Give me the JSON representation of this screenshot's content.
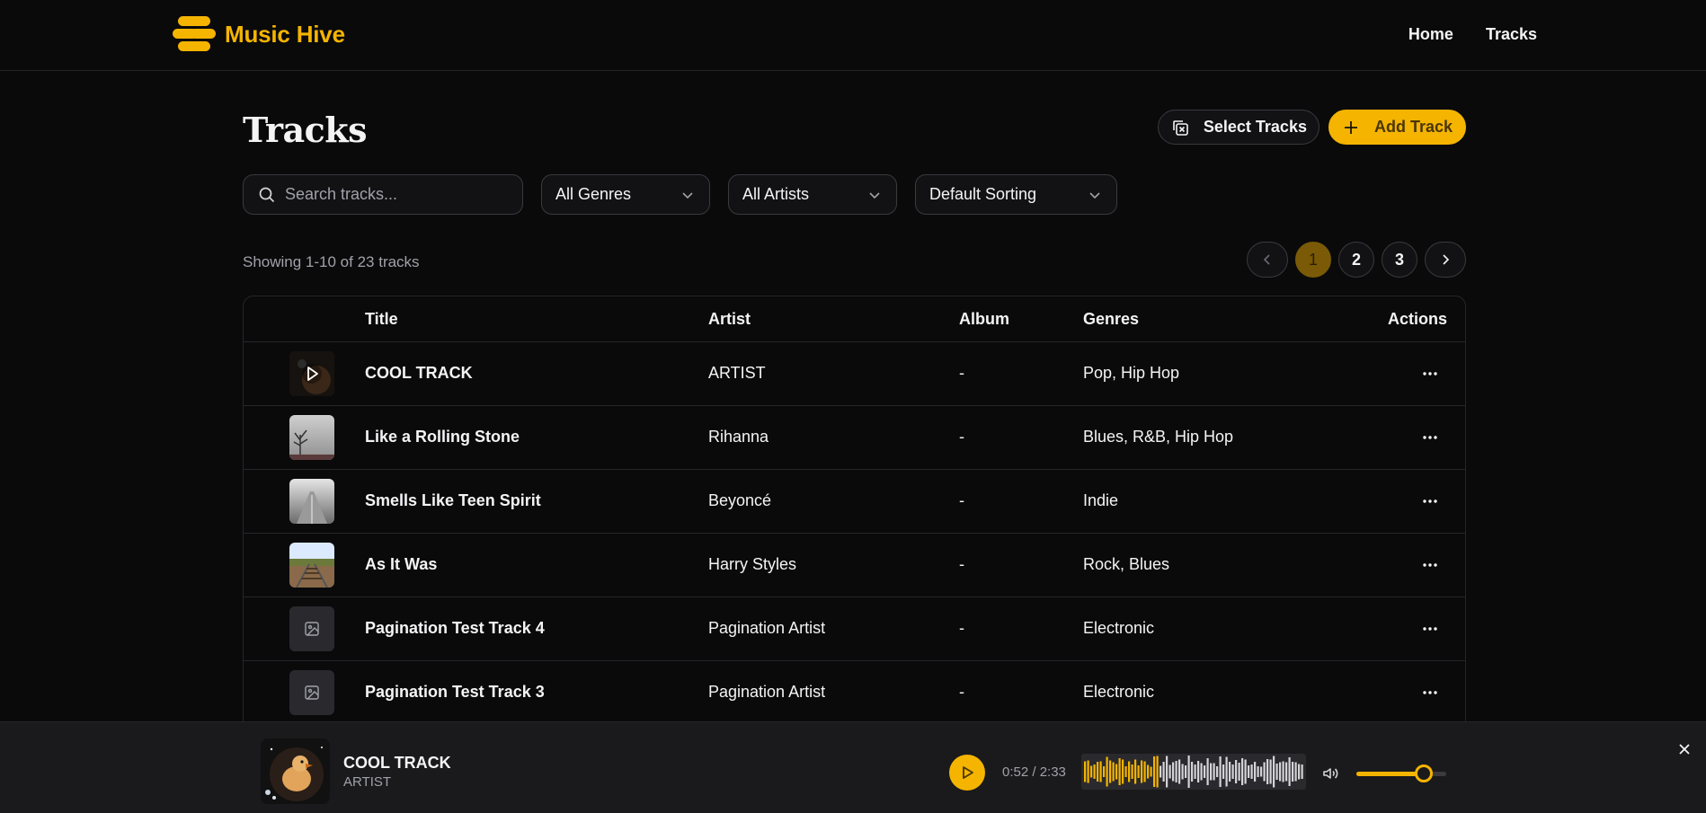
{
  "app": {
    "name": "Music Hive"
  },
  "nav": {
    "home": "Home",
    "tracks": "Tracks"
  },
  "page": {
    "title": "Tracks",
    "select_tracks_label": "Select Tracks",
    "add_track_label": "Add Track"
  },
  "filters": {
    "search_placeholder": "Search tracks...",
    "genre": "All Genres",
    "artist": "All Artists",
    "sort": "Default Sorting"
  },
  "summary": "Showing 1-10 of 23 tracks",
  "pagination": {
    "pages": [
      "1",
      "2",
      "3"
    ],
    "current": "1"
  },
  "table": {
    "columns": {
      "title": "Title",
      "artist": "Artist",
      "album": "Album",
      "genres": "Genres",
      "actions": "Actions"
    },
    "rows": [
      {
        "title": "COOL TRACK",
        "artist": "ARTIST",
        "album": "-",
        "genres": "Pop, Hip Hop",
        "thumb": "dark-play"
      },
      {
        "title": "Like a Rolling Stone",
        "artist": "Rihanna",
        "album": "-",
        "genres": "Blues, R&B, Hip Hop",
        "thumb": "foggy-tree"
      },
      {
        "title": "Smells Like Teen Spirit",
        "artist": "Beyoncé",
        "album": "-",
        "genres": "Indie",
        "thumb": "misty-road"
      },
      {
        "title": "As It Was",
        "artist": "Harry Styles",
        "album": "-",
        "genres": "Rock, Blues",
        "thumb": "railway"
      },
      {
        "title": "Pagination Test Track 4",
        "artist": "Pagination Artist",
        "album": "-",
        "genres": "Electronic",
        "thumb": "placeholder"
      },
      {
        "title": "Pagination Test Track 3",
        "artist": "Pagination Artist",
        "album": "-",
        "genres": "Electronic",
        "thumb": "placeholder"
      }
    ]
  },
  "player": {
    "title": "COOL TRACK",
    "artist": "ARTIST",
    "time": "0:52 / 2:33",
    "progress": 0.34,
    "volume": 0.75
  },
  "colors": {
    "accent": "#f4b400",
    "background": "#0a0a0b",
    "surface": "#1a1a1c"
  }
}
